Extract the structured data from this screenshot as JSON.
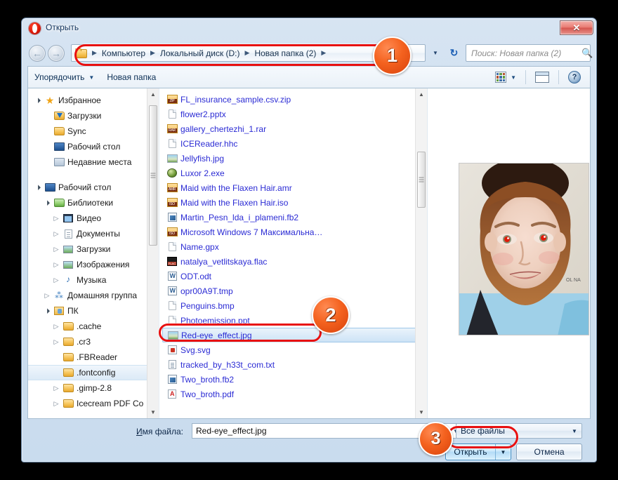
{
  "window": {
    "title": "Открыть",
    "app_icon": "opera-icon",
    "close_label": "✕"
  },
  "address": {
    "folder_icon": "folder-icon",
    "crumbs": [
      "Компьютер",
      "Локальный диск (D:)",
      "Новая папка (2)"
    ],
    "separator": "▶",
    "dropdown_icon": "chevron-down-icon",
    "refresh_icon": "refresh-icon"
  },
  "search": {
    "placeholder": "Поиск: Новая папка (2)",
    "value": "",
    "icon": "search-icon"
  },
  "toolbar": {
    "organize_label": "Упорядочить",
    "organize_caret": "▼",
    "new_folder_label": "Новая папка",
    "view_icon": "view-mode-icon",
    "view_caret": "▼",
    "preview_pane_icon": "preview-pane-icon",
    "help_icon": "help-icon",
    "help_glyph": "?"
  },
  "sidebar": {
    "items": [
      {
        "label": "Избранное",
        "icon": "star-icon",
        "indent": 0,
        "twisty": "open",
        "selected": false
      },
      {
        "label": "Загрузки",
        "icon": "downloads-folder-icon",
        "indent": 1,
        "twisty": "none",
        "selected": false
      },
      {
        "label": "Sync",
        "icon": "folder-icon",
        "indent": 1,
        "twisty": "none",
        "selected": false
      },
      {
        "label": "Рабочий стол",
        "icon": "desktop-icon",
        "indent": 1,
        "twisty": "none",
        "selected": false
      },
      {
        "label": "Недавние места",
        "icon": "recent-places-icon",
        "indent": 1,
        "twisty": "none",
        "selected": false
      },
      {
        "label": "",
        "icon": "spacer",
        "indent": 0,
        "twisty": "none",
        "selected": false
      },
      {
        "label": "Рабочий стол",
        "icon": "desktop-icon",
        "indent": 0,
        "twisty": "open",
        "selected": false
      },
      {
        "label": "Библиотеки",
        "icon": "libraries-icon",
        "indent": 1,
        "twisty": "open",
        "selected": false
      },
      {
        "label": "Видео",
        "icon": "video-icon",
        "indent": 2,
        "twisty": "closed",
        "selected": false
      },
      {
        "label": "Документы",
        "icon": "documents-icon",
        "indent": 2,
        "twisty": "closed",
        "selected": false
      },
      {
        "label": "Загрузки",
        "icon": "downloads-icon",
        "indent": 2,
        "twisty": "closed",
        "selected": false
      },
      {
        "label": "Изображения",
        "icon": "pictures-icon",
        "indent": 2,
        "twisty": "closed",
        "selected": false
      },
      {
        "label": "Музыка",
        "icon": "music-icon",
        "indent": 2,
        "twisty": "closed",
        "selected": false
      },
      {
        "label": "Домашняя группа",
        "icon": "homegroup-icon",
        "indent": 1,
        "twisty": "closed",
        "selected": false
      },
      {
        "label": "ПК",
        "icon": "user-folder-icon",
        "indent": 1,
        "twisty": "open",
        "selected": false
      },
      {
        "label": ".cache",
        "icon": "folder-icon",
        "indent": 2,
        "twisty": "closed",
        "selected": false
      },
      {
        "label": ".cr3",
        "icon": "folder-icon",
        "indent": 2,
        "twisty": "closed",
        "selected": false
      },
      {
        "label": ".FBReader",
        "icon": "folder-icon",
        "indent": 2,
        "twisty": "none",
        "selected": false
      },
      {
        "label": ".fontconfig",
        "icon": "folder-icon",
        "indent": 2,
        "twisty": "none",
        "selected": true
      },
      {
        "label": ".gimp-2.8",
        "icon": "folder-icon",
        "indent": 2,
        "twisty": "closed",
        "selected": false
      },
      {
        "label": "Icecream PDF Co",
        "icon": "folder-icon",
        "indent": 2,
        "twisty": "closed",
        "selected": false
      }
    ],
    "scroll_up_icon": "scroll-up-arrow",
    "scroll_down_icon": "scroll-down-arrow"
  },
  "files": {
    "items": [
      {
        "name": "FL_insurance_sample.csv.zip",
        "icon": "zip-archive-icon",
        "badge": "ZIP",
        "selected": false
      },
      {
        "name": "flower2.pptx",
        "icon": "blank-file-icon",
        "badge": "",
        "selected": false
      },
      {
        "name": "gallery_chertezhi_1.rar",
        "icon": "rar-archive-icon",
        "badge": "RAR",
        "selected": false
      },
      {
        "name": "ICEReader.hhc",
        "icon": "blank-file-icon",
        "badge": "",
        "selected": false
      },
      {
        "name": "Jellyfish.jpg",
        "icon": "image-file-icon",
        "badge": "",
        "selected": false
      },
      {
        "name": "Luxor 2.exe",
        "icon": "executable-icon",
        "badge": "",
        "selected": false
      },
      {
        "name": "Maid with the Flaxen Hair.amr",
        "icon": "audio-file-icon",
        "badge": "AMR",
        "selected": false
      },
      {
        "name": "Maid with the Flaxen Hair.iso",
        "icon": "iso-image-icon",
        "badge": "ISO",
        "selected": false
      },
      {
        "name": "Martin_Pesn_lda_i_plameni.fb2",
        "icon": "fb2-book-icon",
        "badge": "",
        "selected": false
      },
      {
        "name": "Microsoft Windows 7 Максимальна…",
        "icon": "iso-image-icon",
        "badge": "ISO",
        "selected": false
      },
      {
        "name": "Name.gpx",
        "icon": "blank-file-icon",
        "badge": "",
        "selected": false
      },
      {
        "name": "natalya_vetlitskaya.flac",
        "icon": "flac-audio-icon",
        "badge": "FLAC",
        "selected": false
      },
      {
        "name": "ODT.odt",
        "icon": "odt-document-icon",
        "badge": "",
        "selected": false
      },
      {
        "name": "opr00A9T.tmp",
        "icon": "odt-document-icon",
        "badge": "",
        "selected": false
      },
      {
        "name": "Penguins.bmp",
        "icon": "blank-file-icon",
        "badge": "",
        "selected": false
      },
      {
        "name": "Photoemission.ppt",
        "icon": "blank-file-icon",
        "badge": "",
        "selected": false
      },
      {
        "name": "Red-eye_effect.jpg",
        "icon": "image-file-icon",
        "badge": "",
        "selected": true
      },
      {
        "name": "Svg.svg",
        "icon": "svg-file-icon",
        "badge": "",
        "selected": false
      },
      {
        "name": "tracked_by_h33t_com.txt",
        "icon": "text-file-icon",
        "badge": "",
        "selected": false
      },
      {
        "name": "Two_broth.fb2",
        "icon": "fb2-book-icon",
        "badge": "",
        "selected": false
      },
      {
        "name": "Two_broth.pdf",
        "icon": "pdf-file-icon",
        "badge": "",
        "selected": false
      }
    ]
  },
  "preview": {
    "image_description": "portrait-photo-with-red-eye"
  },
  "bottom": {
    "filename_label_prefix": "И",
    "filename_label_rest": "мя файла:",
    "filename_value": "Red-eye_effect.jpg",
    "filename_caret": "▼",
    "filter_value": "Все файлы",
    "filter_caret": "▼",
    "open_label": "Открыть",
    "open_caret": "▼",
    "cancel_label": "Отмена"
  },
  "annotations": {
    "badges": [
      {
        "number": "1"
      },
      {
        "number": "2"
      },
      {
        "number": "3"
      }
    ],
    "ring_color": "#e81010",
    "badge_color": "#f4621f"
  }
}
